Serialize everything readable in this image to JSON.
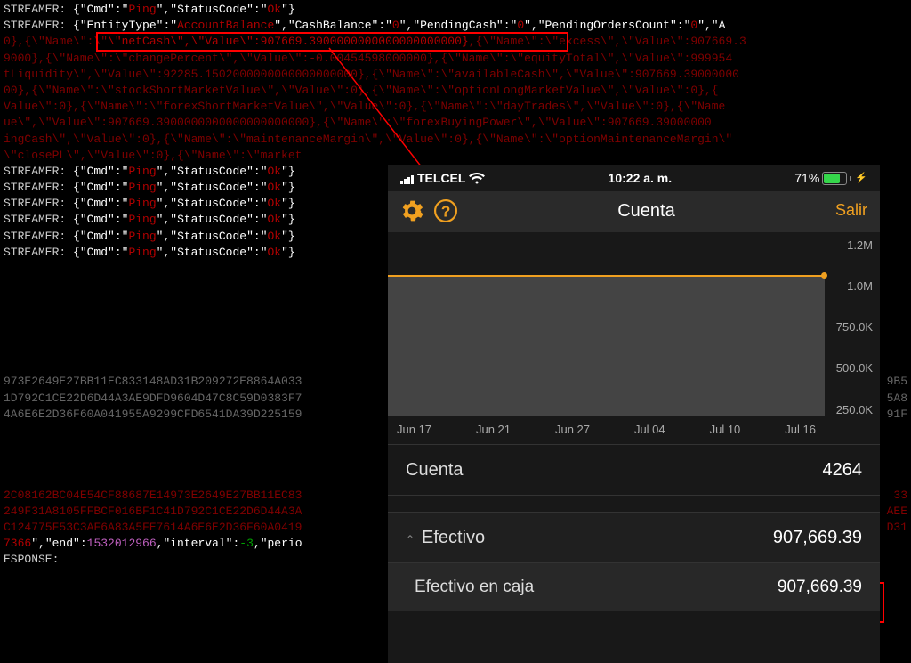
{
  "log": {
    "streamer": "STREAMER:",
    "ping": "{\"Cmd\":\"Ping\",\"StatusCode\":\"Ok\"}",
    "entity_prefix": "{\"EntityType\":\"",
    "entity_type": "AccountBalance",
    "entity_mid": "\",\"CashBalance\":\"",
    "zero": "0",
    "entity_mid2": "\",\"PendingCash\":\"",
    "entity_mid3": "\",\"PendingOrdersCount\":\"",
    "entity_suffix": "\",\"A",
    "hl_netcash": "\\\"netCash\\\",\\\"Value\\\":907669.3900000000000000000000}",
    "after_hl": ",{\\\"Name\\\":\\\"excess\\\",\\\"Value\\\":907669.3",
    "line3": "0},{\\\"Name\\\":\\\"",
    "l3a": "9000},{\\\"Name\\\":\\\"changePercent\\\",\\\"Value\\\":-0.00454598000000},{\\\"Name\\\":\\\"equityTotal\\\",\\\"Value\\\":999954",
    "l4": "tLiquidity\\\",\\\"Value\\\":92285.1502000000000000000000},{\\\"Name\\\":\\\"availableCash\\\",\\\"Value\\\":907669.39000000",
    "l5": "00},{\\\"Name\\\":\\\"stockShortMarketValue\\\",\\\"Value\\\":0},{\\\"Name\\\":\\\"optionLongMarketValue\\\",\\\"Value\\\":0},{",
    "l6": "Value\\\":0},{\\\"Name\\\":\\\"forexShortMarketValue\\\",\\\"Value\\\":0},{\\\"Name\\\":\\\"dayTrades\\\",\\\"Value\\\":0},{\\\"Name",
    "l7": "ue\\\",\\\"Value\\\":907669.3900000000000000000000},{\\\"Name\\\":\\\"forexBuyingPower\\\",\\\"Value\\\":907669.39000000",
    "l8": "ingCash\\\",\\\"Value\\\":0},{\\\"Name\\\":\\\"maintenanceMargin\\\",\\\"Value\\\":0},{\\\"Name\\\":\\\"optionMaintenanceMargin\\\"",
    "l9": "\\\"closePL\\\",\\\"Value\\\":0},{\\\"Name\\\":\\\"market",
    "hex1": "973E2649E27BB11EC833148AD31B209272E8864A033",
    "hex2": "1D792C1CE22D6D44A3AE9DFD9604D47C8C59D0383F7",
    "hex3": "4A6E6E2D36F60A041955A9299CFD6541DA39D225159",
    "hex1r": "9B5",
    "hex2r": "5A8",
    "hex3r": "91F",
    "hex4": "2C08162BC04E54CF88687E14973E2649E27BB11EC83",
    "hex4r": "33",
    "hex5": "249F31A8105FFBCF016BF1C41D792C1CE22D6D44A3A",
    "hex5r": "AEE",
    "hex6": "C124775F53C3AF6A83A5FE7614A6E6E2D36F60A0419",
    "hex6r": "D31",
    "endline_a": "7366",
    "endline_b": "\",\"end\":",
    "endline_c": "1532012966",
    "endline_d": ",\"interval\":",
    "endline_e": "-3",
    "endline_f": ",\"perio",
    "response": "ESPONSE:"
  },
  "phone": {
    "carrier": "TELCEL",
    "time": "10:22 a. m.",
    "battery": "71%",
    "title": "Cuenta",
    "exit": "Salir",
    "account_label": "Cuenta",
    "account_value": "4264",
    "cash_label": "Efectivo",
    "cash_value": "907,669.39",
    "cashbox_label": "Efectivo en caja",
    "cashbox_value": "907,669.39"
  },
  "chart_data": {
    "type": "area",
    "categories": [
      "Jun 17",
      "Jun 21",
      "Jun 27",
      "Jul 04",
      "Jul 10",
      "Jul 16"
    ],
    "values": [
      1000000,
      1000000,
      1000000,
      1000000,
      1000000,
      1000000
    ],
    "ylabels": [
      "1.2M",
      "1.0M",
      "750.0K",
      "500.0K",
      "250.0K"
    ],
    "ylim": [
      0,
      1200000
    ]
  }
}
